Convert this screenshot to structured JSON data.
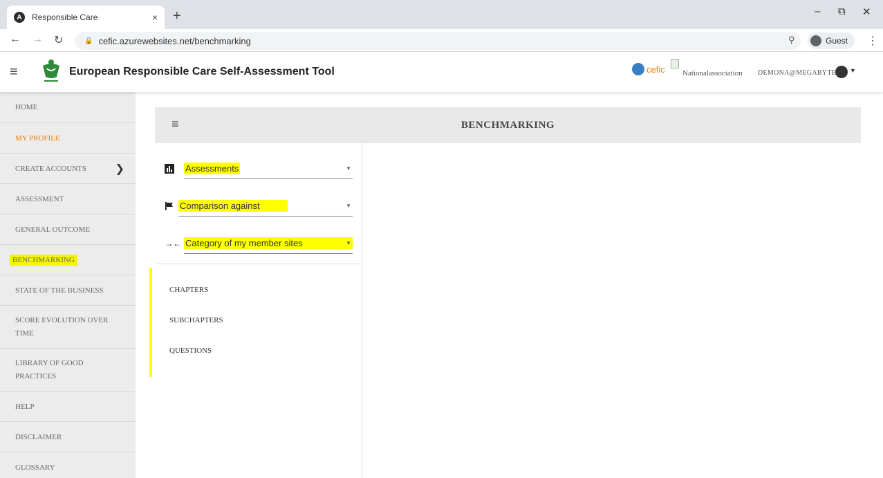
{
  "browser": {
    "tab_title": "Responsible Care",
    "tab_close": "×",
    "new_tab": "+",
    "url": "cefic.azurewebsites.net/benchmarking",
    "profile_label": "Guest",
    "minimize": "–",
    "restore": "⧉",
    "close": "✕"
  },
  "header": {
    "title": "European Responsible Care Self-Assessment Tool",
    "cefic_label": "cefic",
    "national_association": "Nationalassociation",
    "user_email": "DEMONA@MEGABYTE.BE"
  },
  "sidebar": {
    "items": [
      {
        "label": "HOME"
      },
      {
        "label": "MY PROFILE"
      },
      {
        "label": "CREATE ACCOUNTS"
      },
      {
        "label": "ASSESSMENT"
      },
      {
        "label": "GENERAL OUTCOME"
      },
      {
        "label": "BENCHMARKING"
      },
      {
        "label": "STATE OF THE BUSINESS"
      },
      {
        "label": "SCORE EVOLUTION OVER TIME"
      },
      {
        "label": "LIBRARY OF GOOD PRACTICES"
      },
      {
        "label": "HELP"
      },
      {
        "label": "DISCLAIMER"
      },
      {
        "label": "GLOSSARY"
      }
    ]
  },
  "benchmarking": {
    "title": "BENCHMARKING",
    "filters": [
      {
        "label": "Assessments",
        "icon": "bar-chart-icon"
      },
      {
        "label": "Comparison against",
        "icon": "flag-icon"
      },
      {
        "label": "Category of my member sites",
        "icon": "compare-arrows-icon"
      }
    ],
    "links": [
      {
        "label": "CHAPTERS"
      },
      {
        "label": "SUBCHAPTERS"
      },
      {
        "label": "QUESTIONS"
      }
    ]
  },
  "colors": {
    "highlight": "#ffff00",
    "accent_orange": "#f07c00",
    "sidebar_bg": "#ececec",
    "header_bar_bg": "#e9e9e9"
  }
}
